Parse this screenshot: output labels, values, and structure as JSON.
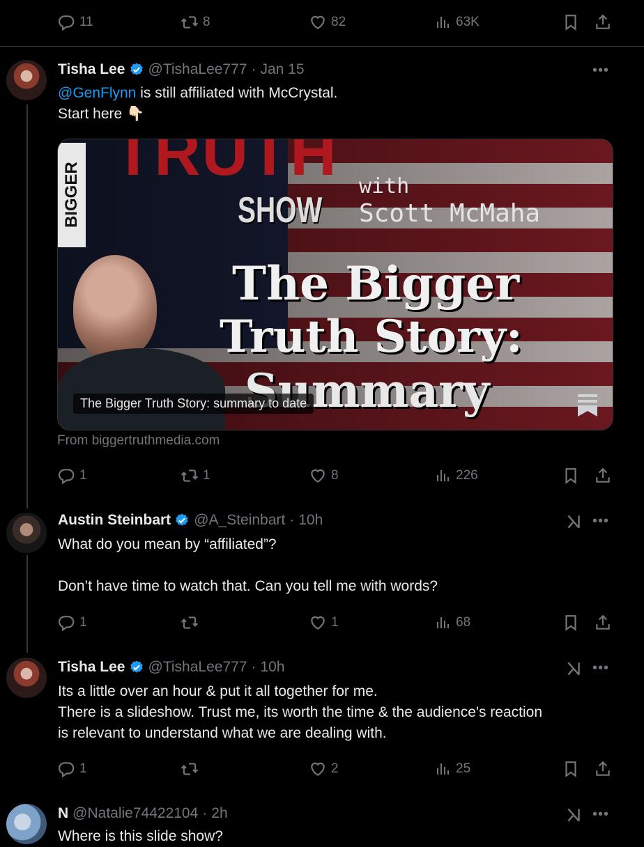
{
  "top_actions": {
    "replies": "11",
    "reposts": "8",
    "likes": "82",
    "views": "63K"
  },
  "tweets": [
    {
      "name": "Tisha Lee",
      "handle": "@TishaLee777",
      "dot": "·",
      "time": "Jan 15",
      "mention": "@GenFlynn",
      "text_after_mention": " is still affiliated with McCrystal.",
      "line2": "Start here 👇🏻",
      "card": {
        "img_text": {
          "truth": "TRUTH",
          "show": "SHOW",
          "with": "with",
          "host": "Scott McMaha",
          "bigger": "The Bigger",
          "story": "Truth Story:",
          "summary": "Summary",
          "side": "BIGGER"
        },
        "title": "The Bigger Truth Story: summary to date",
        "source": "From biggertruthmedia.com"
      },
      "actions": {
        "replies": "1",
        "reposts": "1",
        "likes": "8",
        "views": "226"
      }
    },
    {
      "name": "Austin Steinbart",
      "handle": "@A_Steinbart",
      "dot": "·",
      "time": "10h",
      "text": "What do you mean by “affiliated”?\n\nDon’t have time to watch that. Can you tell me with words?",
      "actions": {
        "replies": "1",
        "reposts": "",
        "likes": "1",
        "views": "68"
      }
    },
    {
      "name": "Tisha Lee",
      "handle": "@TishaLee777",
      "dot": "·",
      "time": "10h",
      "text": "Its a little over an hour & put it all together for me.\nThere is a slideshow. Trust me, its worth the time & the audience's reaction\nis relevant to understand what we are dealing with.",
      "actions": {
        "replies": "1",
        "reposts": "",
        "likes": "2",
        "views": "25"
      }
    },
    {
      "name": "N",
      "handle": "@Natalie74422104",
      "dot": "·",
      "time": "2h",
      "text": "Where is this slide show?"
    }
  ],
  "more_label": "•••",
  "colors": {
    "bg": "#000000",
    "text": "#e7e9ea",
    "muted": "#71767b",
    "link": "#1d9bf0",
    "verified": "#1d9bf0"
  }
}
